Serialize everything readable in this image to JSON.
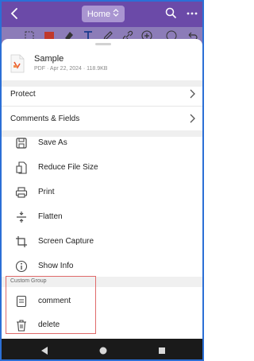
{
  "topbar": {
    "home_label": "Home",
    "accent_color": "#6b4aa8"
  },
  "file": {
    "name": "Sample",
    "meta": "PDF · Apr 22, 2024 · 118.9KB"
  },
  "sections": [
    {
      "label": "Protect"
    },
    {
      "label": "Comments & Fields"
    }
  ],
  "actions": [
    {
      "label": "Save As",
      "icon": "save-icon"
    },
    {
      "label": "Reduce File Size",
      "icon": "reduce-file-icon"
    },
    {
      "label": "Print",
      "icon": "print-icon"
    },
    {
      "label": "Flatten",
      "icon": "flatten-icon"
    },
    {
      "label": "Screen Capture",
      "icon": "crop-icon"
    },
    {
      "label": "Show Info",
      "icon": "info-icon"
    }
  ],
  "custom_group": {
    "title": "Custom Group",
    "items": [
      {
        "label": "comment",
        "icon": "comment-icon"
      },
      {
        "label": "delete",
        "icon": "trash-icon"
      }
    ]
  }
}
